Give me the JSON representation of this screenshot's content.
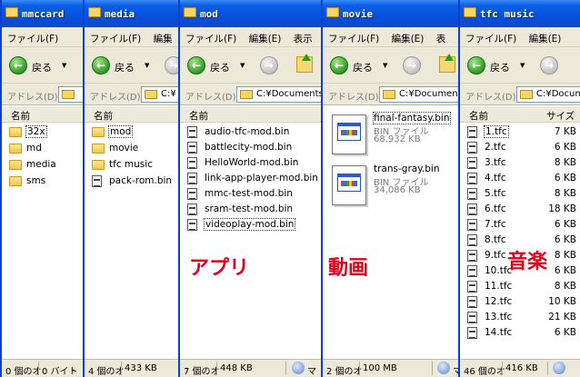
{
  "common": {
    "menu": [
      "ファイル(F)",
      "編集",
      "表示"
    ],
    "back_label": "戻る",
    "address_label": "アドレス(D)",
    "col_name": "名前",
    "col_size": "サイズ"
  },
  "windows": [
    {
      "title": "mmccard",
      "menu": [
        "ファイル(F)"
      ],
      "address": "",
      "items": [
        {
          "name": "32x",
          "type": "folder",
          "selected": true
        },
        {
          "name": "md",
          "type": "folder"
        },
        {
          "name": "media",
          "type": "folder"
        },
        {
          "name": "sms",
          "type": "folder"
        }
      ],
      "status_count": "0 個のオ",
      "status_size": "0 バイト"
    },
    {
      "title": "media",
      "menu": [
        "ファイル(F)",
        "編集"
      ],
      "address": "C:¥",
      "items": [
        {
          "name": "mod",
          "type": "folder",
          "selected": true
        },
        {
          "name": "movie",
          "type": "folder"
        },
        {
          "name": "tfc music",
          "type": "folder"
        },
        {
          "name": "pack-rom.bin",
          "type": "bin"
        }
      ],
      "status_count": "4 個のオ",
      "status_size": "433 KB"
    },
    {
      "title": "mod",
      "menu": [
        "ファイル(F)",
        "編集(E)",
        "表示"
      ],
      "address": "C:¥Documents",
      "items": [
        {
          "name": "audio-tfc-mod.bin",
          "type": "bin"
        },
        {
          "name": "battlecity-mod.bin",
          "type": "bin"
        },
        {
          "name": "HelloWorld-mod.bin",
          "type": "bin"
        },
        {
          "name": "link-app-player-mod.bin",
          "type": "bin"
        },
        {
          "name": "mmc-test-mod.bin",
          "type": "bin"
        },
        {
          "name": "sram-test-mod.bin",
          "type": "bin"
        },
        {
          "name": "videoplay-mod.bin",
          "type": "bin",
          "selected": true
        }
      ],
      "caption": "アプリ",
      "status_count": "7 個のオ",
      "status_size": "448 KB",
      "status_extra": "マ"
    },
    {
      "title": "movie",
      "menu": [
        "ファイル(F)",
        "編集(E)",
        "表"
      ],
      "address": "C:¥Documen",
      "tiles": [
        {
          "name": "final-fantasy.bin",
          "type_label": "BIN ファイル",
          "size": "68,932 KB",
          "selected": true
        },
        {
          "name": "trans-gray.bin",
          "type_label": "BIN ファイル",
          "size": "34,086 KB"
        }
      ],
      "caption": "動画",
      "status_count": "2 個のオ",
      "status_size": "100 MB",
      "status_extra": "マ"
    },
    {
      "title": "tfc music",
      "menu": [
        "ファイル(F)",
        "編集(E)"
      ],
      "address": "C:¥Docume",
      "items": [
        {
          "name": "1.tfc",
          "size": "7 KB",
          "type": "bin",
          "selected": true
        },
        {
          "name": "2.tfc",
          "size": "6 KB",
          "type": "bin"
        },
        {
          "name": "3.tfc",
          "size": "8 KB",
          "type": "bin"
        },
        {
          "name": "4.tfc",
          "size": "6 KB",
          "type": "bin"
        },
        {
          "name": "5.tfc",
          "size": "8 KB",
          "type": "bin"
        },
        {
          "name": "6.tfc",
          "size": "18 KB",
          "type": "bin"
        },
        {
          "name": "7.tfc",
          "size": "6 KB",
          "type": "bin"
        },
        {
          "name": "8.tfc",
          "size": "6 KB",
          "type": "bin"
        },
        {
          "name": "9.tfc",
          "size": "8 KB",
          "type": "bin"
        },
        {
          "name": "10.tfc",
          "size": "6 KB",
          "type": "bin"
        },
        {
          "name": "11.tfc",
          "size": "8 KB",
          "type": "bin"
        },
        {
          "name": "12.tfc",
          "size": "10 KB",
          "type": "bin"
        },
        {
          "name": "13.tfc",
          "size": "21 KB",
          "type": "bin"
        },
        {
          "name": "14.tfc",
          "size": "6 KB",
          "type": "bin"
        }
      ],
      "caption": "音楽",
      "status_count": "46 個のオ",
      "status_size": "416 KB"
    }
  ]
}
